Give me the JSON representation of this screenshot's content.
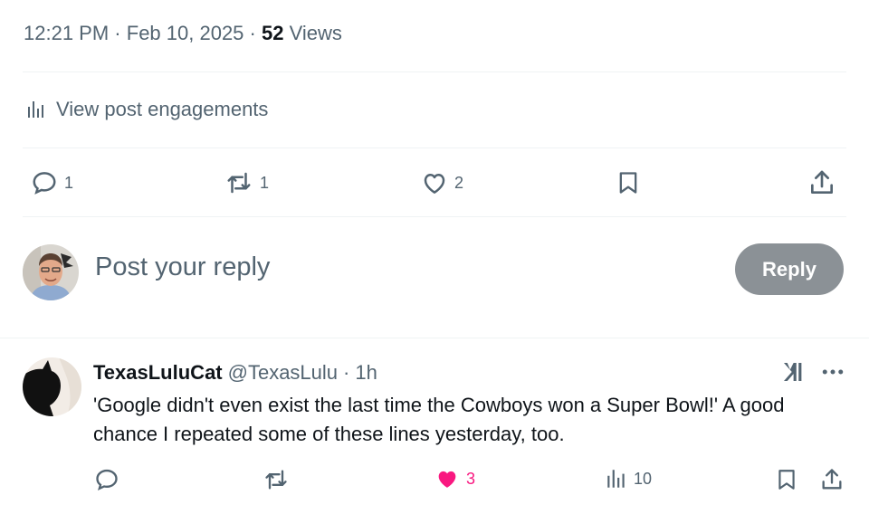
{
  "post_meta": {
    "time": "12:21 PM",
    "date": "Feb 10, 2025",
    "separator": "·",
    "views_count": "52",
    "views_label": "Views"
  },
  "engagements": {
    "label": "View post engagements"
  },
  "post_actions": {
    "replies": "1",
    "reposts": "1",
    "likes": "2"
  },
  "composer": {
    "placeholder": "Post your reply",
    "button_label": "Reply"
  },
  "reply_tweet": {
    "display_name": "TexasLuluCat",
    "handle": "@TexasLulu",
    "separator": "·",
    "time": "1h",
    "text": "'Google didn't even exist the last time the Cowboys won a Super Bowl!'  A good chance I repeated some of these lines yesterday, too.",
    "likes": "3",
    "views": "10"
  },
  "colors": {
    "text_primary": "#0f1419",
    "text_secondary": "#536471",
    "like_active": "#f91880",
    "reply_button_disabled": "#8b9196",
    "divider": "#eff3f4"
  },
  "icons": [
    "analytics-icon",
    "reply-icon",
    "repost-icon",
    "like-icon",
    "bookmark-icon",
    "share-icon",
    "grok-icon",
    "more-icon"
  ]
}
